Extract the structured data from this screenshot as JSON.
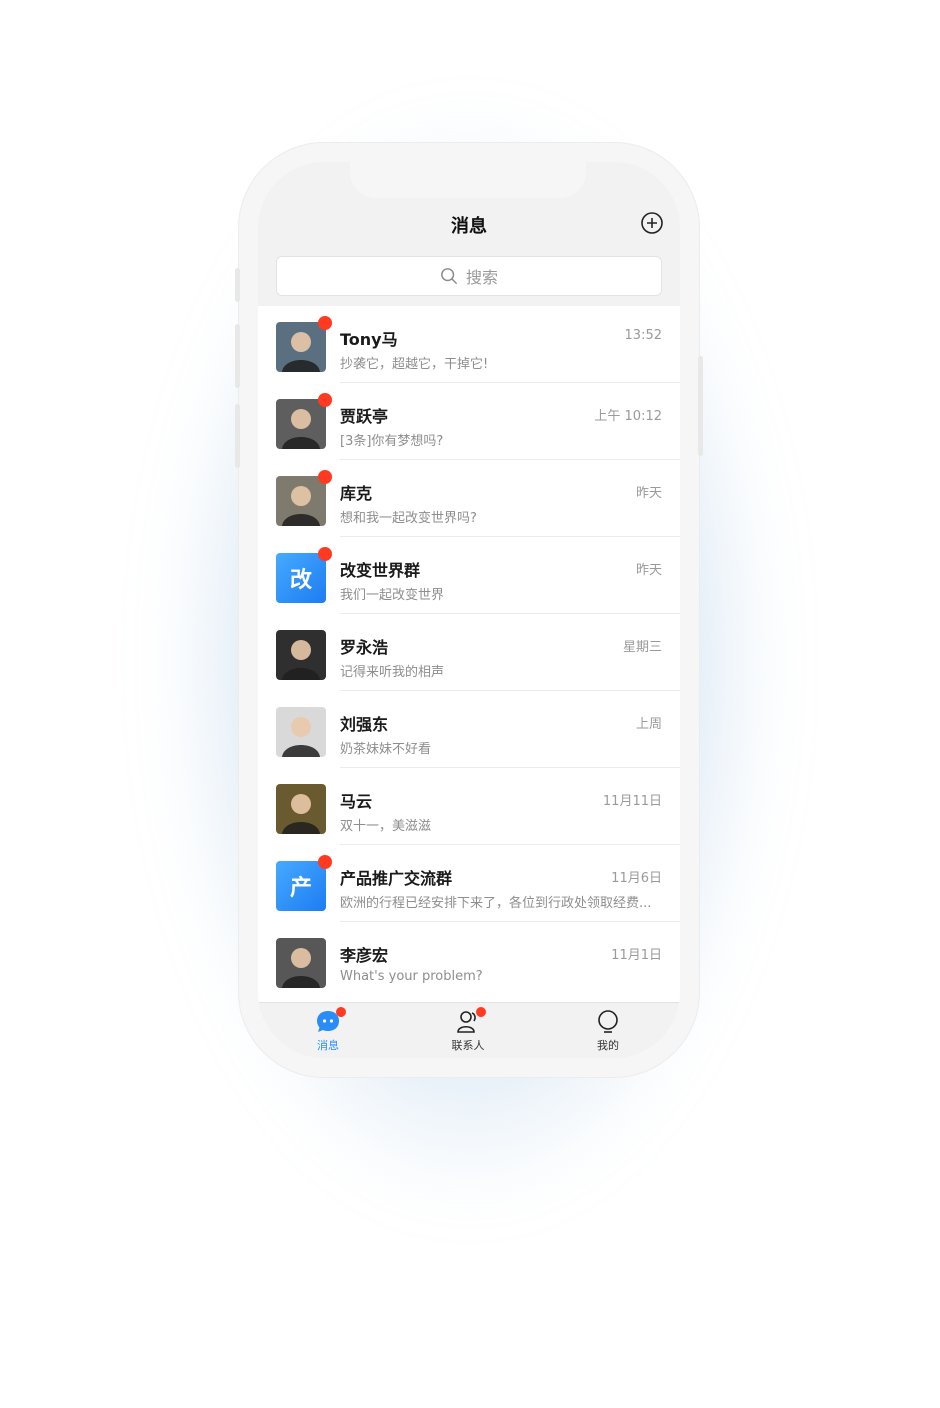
{
  "header": {
    "title": "消息"
  },
  "search": {
    "placeholder": "搜索"
  },
  "conversations": [
    {
      "name": "Tony马",
      "time": "13:52",
      "preview": "抄袭它，超越它，干掉它!",
      "unread": true,
      "avatar": "photo",
      "tone": "#5a7080"
    },
    {
      "name": "贾跃亭",
      "time": "上午 10:12",
      "preview": "[3条]你有梦想吗?",
      "unread": true,
      "avatar": "photo",
      "tone": "#5e5e5e"
    },
    {
      "name": "库克",
      "time": "昨天",
      "preview": "想和我一起改变世界吗?",
      "unread": true,
      "avatar": "photo",
      "tone": "#7f7a6e"
    },
    {
      "name": "改变世界群",
      "time": "昨天",
      "preview": "我们一起改变世界",
      "unread": true,
      "avatar": "text",
      "avatar_text": "改"
    },
    {
      "name": "罗永浩",
      "time": "星期三",
      "preview": "记得来听我的相声",
      "unread": false,
      "avatar": "photo",
      "tone": "#2f2f2f"
    },
    {
      "name": "刘强东",
      "time": "上周",
      "preview": "奶茶妹妹不好看",
      "unread": false,
      "avatar": "photo",
      "tone": "#d9d9d9"
    },
    {
      "name": "马云",
      "time": "11月11日",
      "preview": "双十一，美滋滋",
      "unread": false,
      "avatar": "photo",
      "tone": "#6a5a30"
    },
    {
      "name": "产品推广交流群",
      "time": "11月6日",
      "preview": "欧洲的行程已经安排下来了，各位到行政处领取经费...",
      "unread": true,
      "avatar": "text",
      "avatar_text": "产"
    },
    {
      "name": "李彦宏",
      "time": "11月1日",
      "preview": "What's your problem?",
      "unread": false,
      "avatar": "photo",
      "tone": "#575757"
    }
  ],
  "tabs": [
    {
      "label": "消息",
      "icon": "chat-bubble-icon",
      "active": true,
      "badge": true
    },
    {
      "label": "联系人",
      "icon": "contacts-icon",
      "active": false,
      "badge": true
    },
    {
      "label": "我的",
      "icon": "bulb-icon",
      "active": false,
      "badge": false
    }
  ],
  "colors": {
    "accent": "#2a8cf5",
    "badge": "#ff3a20"
  }
}
